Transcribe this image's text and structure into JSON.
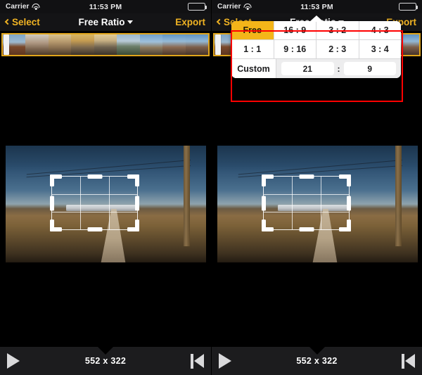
{
  "status_bar": {
    "carrier": "Carrier",
    "time": "11:53 PM",
    "wifi_icon": "wifi-icon",
    "battery_icon": "battery-full-icon"
  },
  "nav_bar": {
    "back_label": "Select",
    "back_icon": "chevron-left-icon",
    "title": "Free Ratio",
    "title_caret_icon": "triangle-down-icon",
    "export_label": "Export"
  },
  "filmstrip": {
    "playhead_name": "playhead",
    "border_color": "#e0a51b",
    "thumbnail_count": 9
  },
  "ratio_popover": {
    "visible_in": "right",
    "rows": [
      [
        {
          "label": "Free",
          "selected": true
        },
        {
          "label": "16 : 9",
          "selected": false
        },
        {
          "label": "3 : 2",
          "selected": false
        },
        {
          "label": "4 : 3",
          "selected": false
        }
      ],
      [
        {
          "label": "1 : 1",
          "selected": false
        },
        {
          "label": "9 : 16",
          "selected": false
        },
        {
          "label": "2 : 3",
          "selected": false
        },
        {
          "label": "3 : 4",
          "selected": false
        }
      ]
    ],
    "custom": {
      "label": "Custom",
      "width_value": "21",
      "separator": ":",
      "height_value": "9"
    },
    "selected_color": "#f4b519",
    "highlight_color": "#ff0000"
  },
  "canvas": {
    "crop_overlay_name": "crop-overlay",
    "grid": "rule-of-thirds"
  },
  "bottom_bar": {
    "play_icon": "play-icon",
    "dimensions": "552 x 322",
    "skip_start_icon": "skip-to-start-icon"
  }
}
